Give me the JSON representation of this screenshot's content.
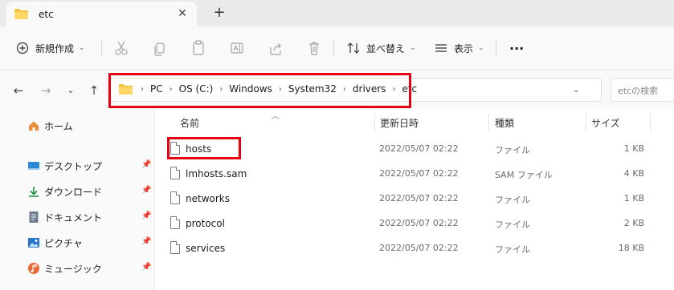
{
  "tab": {
    "title": "etc",
    "close": "✕",
    "new_tab": "+"
  },
  "toolbar": {
    "new_label": "新規作成",
    "sort_label": "並べ替え",
    "view_label": "表示",
    "more_label": "···"
  },
  "address": {
    "breadcrumb": [
      "PC",
      "OS (C:)",
      "Windows",
      "System32",
      "drivers",
      "etc"
    ],
    "search_placeholder": "etcの検索"
  },
  "sidebar": {
    "items": [
      {
        "label": "ホーム",
        "icon": "home-icon"
      },
      {
        "label": "デスクトップ",
        "icon": "desktop-icon",
        "pinned": true
      },
      {
        "label": "ダウンロード",
        "icon": "download-icon",
        "pinned": true
      },
      {
        "label": "ドキュメント",
        "icon": "document-icon",
        "pinned": true
      },
      {
        "label": "ピクチャ",
        "icon": "pictures-icon",
        "pinned": true
      },
      {
        "label": "ミュージック",
        "icon": "music-icon",
        "pinned": true
      }
    ]
  },
  "columns": {
    "name": "名前",
    "date": "更新日時",
    "type": "種類",
    "size": "サイズ"
  },
  "files": [
    {
      "name": "hosts",
      "date": "2022/05/07 02:22",
      "type": "ファイル",
      "size": "1 KB"
    },
    {
      "name": "lmhosts.sam",
      "date": "2022/05/07 02:22",
      "type": "SAM ファイル",
      "size": "4 KB"
    },
    {
      "name": "networks",
      "date": "2022/05/07 02:22",
      "type": "ファイル",
      "size": "1 KB"
    },
    {
      "name": "protocol",
      "date": "2022/05/07 02:22",
      "type": "ファイル",
      "size": "2 KB"
    },
    {
      "name": "services",
      "date": "2022/05/07 02:22",
      "type": "ファイル",
      "size": "18 KB"
    }
  ],
  "colors": {
    "highlight": "#e60012",
    "folder": "#f4c542",
    "accent": "#0067c0"
  }
}
